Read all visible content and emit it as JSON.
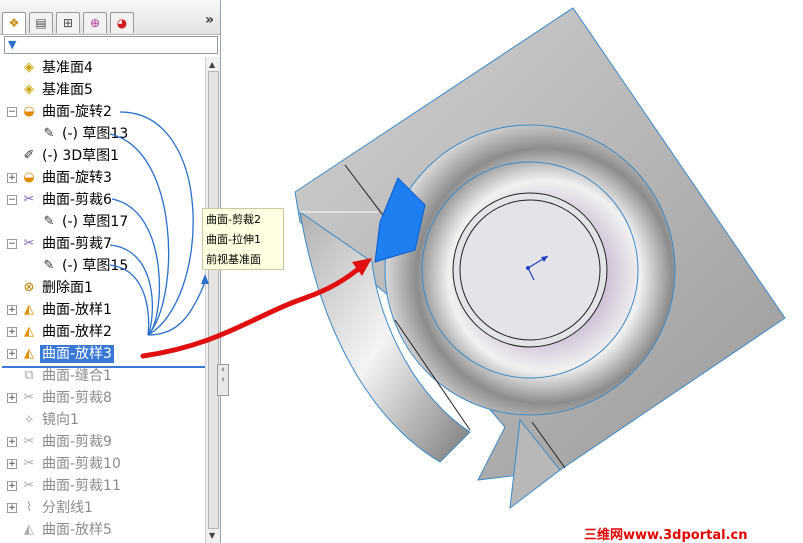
{
  "feature_manager": {
    "tabs": [
      {
        "icon": "feature-tree-icon"
      },
      {
        "icon": "property-manager-icon"
      },
      {
        "icon": "configuration-manager-icon"
      },
      {
        "icon": "dimxpert-icon"
      },
      {
        "icon": "display-manager-icon"
      }
    ],
    "more_label": "»",
    "filter": {
      "icon": "filter-icon",
      "value": ""
    },
    "tree_items": [
      {
        "label": "基准面4",
        "icon": "plane-icon",
        "expandable": false,
        "state": "normal"
      },
      {
        "label": "基准面5",
        "icon": "plane-icon",
        "expandable": false,
        "state": "normal"
      },
      {
        "label": "曲面-旋转2",
        "icon": "surface-revolve-icon",
        "expandable": true,
        "state": "normal"
      },
      {
        "label": "(-) 草图13",
        "icon": "sketch-icon",
        "expandable": false,
        "state": "normal"
      },
      {
        "label": "(-) 3D草图1",
        "icon": "3d-sketch-icon",
        "expandable": false,
        "state": "normal"
      },
      {
        "label": "曲面-旋转3",
        "icon": "surface-revolve-icon",
        "expandable": true,
        "state": "normal"
      },
      {
        "label": "曲面-剪裁6",
        "icon": "surface-trim-icon",
        "expandable": true,
        "state": "normal"
      },
      {
        "label": "(-) 草图17",
        "icon": "sketch-icon",
        "expandable": false,
        "state": "normal"
      },
      {
        "label": "曲面-剪裁7",
        "icon": "surface-trim-icon",
        "expandable": true,
        "state": "normal"
      },
      {
        "label": "(-) 草图15",
        "icon": "sketch-icon",
        "expandable": false,
        "state": "normal"
      },
      {
        "label": "删除面1",
        "icon": "delete-face-icon",
        "expandable": false,
        "state": "normal"
      },
      {
        "label": "曲面-放样1",
        "icon": "surface-loft-icon",
        "expandable": true,
        "state": "normal"
      },
      {
        "label": "曲面-放样2",
        "icon": "surface-loft-icon",
        "expandable": true,
        "state": "normal"
      },
      {
        "label": "曲面-放样3",
        "icon": "surface-loft-icon",
        "expandable": true,
        "state": "selected"
      },
      {
        "label": "曲面-缝合1",
        "icon": "surface-knit-icon",
        "expandable": false,
        "state": "suppressed"
      },
      {
        "label": "曲面-剪裁8",
        "icon": "surface-trim-icon",
        "expandable": true,
        "state": "suppressed"
      },
      {
        "label": "镜向1",
        "icon": "mirror-icon",
        "expandable": false,
        "state": "suppressed"
      },
      {
        "label": "曲面-剪裁9",
        "icon": "surface-trim-icon",
        "expandable": true,
        "state": "suppressed"
      },
      {
        "label": "曲面-剪裁10",
        "icon": "surface-trim-icon",
        "expandable": true,
        "state": "suppressed"
      },
      {
        "label": "曲面-剪裁11",
        "icon": "surface-trim-icon",
        "expandable": true,
        "state": "suppressed"
      },
      {
        "label": "分割线1",
        "icon": "split-line-icon",
        "expandable": true,
        "state": "suppressed"
      },
      {
        "label": "曲面-放样5",
        "icon": "surface-loft-icon",
        "expandable": false,
        "state": "suppressed"
      }
    ]
  },
  "tooltip": {
    "lines": [
      "曲面-剪裁2",
      "曲面-拉伸1",
      "前视基准面"
    ]
  },
  "viewport": {
    "triad_icon": "coordinate-triad-icon"
  },
  "watermark": "三维网www.3dportal.cn",
  "colors": {
    "selection": "#3a78d6",
    "selected_face": "#1e7ff0",
    "annotation_arrow": "#e01010",
    "parent_child_lines": "#2a6fc9",
    "suppressed_text": "#8c8c8c",
    "watermark": "#e00000"
  }
}
